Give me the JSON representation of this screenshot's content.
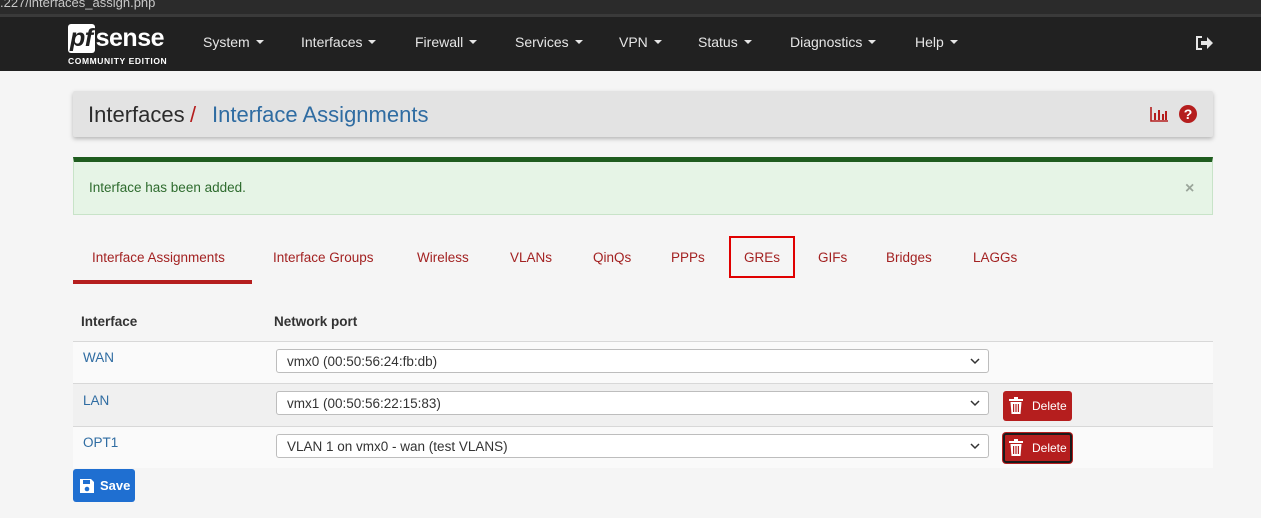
{
  "browser": {
    "url_fragment": ".227/interfaces_assign.php"
  },
  "navbar": {
    "brand_pf": "pf",
    "brand_sense": "sense",
    "brand_edition": "COMMUNITY EDITION",
    "menu": [
      "System",
      "Interfaces",
      "Firewall",
      "Services",
      "VPN",
      "Status",
      "Diagnostics",
      "Help"
    ]
  },
  "breadcrumb": {
    "section": "Interfaces",
    "separator": "/",
    "page": "Interface Assignments"
  },
  "alert": {
    "message": "Interface has been added.",
    "close": "×"
  },
  "tabs": [
    "Interface Assignments",
    "Interface Groups",
    "Wireless",
    "VLANs",
    "QinQs",
    "PPPs",
    "GREs",
    "GIFs",
    "Bridges",
    "LAGGs"
  ],
  "active_tab": "Interface Assignments",
  "highlighted_tab": "GREs",
  "table": {
    "headers": [
      "Interface",
      "Network port"
    ],
    "rows": [
      {
        "interface": "WAN",
        "port": "vmx0 (00:50:56:24:fb:db)",
        "delete_label": ""
      },
      {
        "interface": "LAN",
        "port": "vmx1 (00:50:56:22:15:83)",
        "delete_label": "Delete"
      },
      {
        "interface": "OPT1",
        "port": "VLAN 1 on vmx0 - wan (test VLANS)",
        "delete_label": "Delete"
      }
    ]
  },
  "save_label": "Save",
  "colors": {
    "accent_red": "#b51e1e",
    "link_blue": "#2f6ca2",
    "save_blue": "#1f6fd1",
    "navbar": "#212121"
  }
}
